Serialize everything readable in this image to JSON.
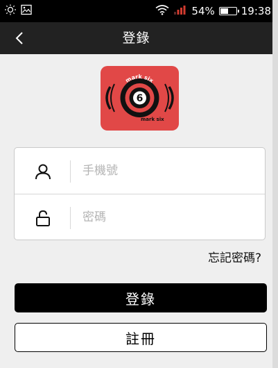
{
  "status_bar": {
    "battery_percent_text": "54%",
    "battery_level": 0.54,
    "time": "19:38",
    "icons": [
      "brightness-icon",
      "image-notification-icon",
      "wifi-icon",
      "cellular-signal-icon",
      "battery-icon"
    ]
  },
  "nav": {
    "title": "登錄",
    "back_icon": "chevron-left-icon"
  },
  "logo": {
    "icon": "mark-six-ball-logo",
    "text_top": "mark six",
    "text_bottom": "mark six",
    "ball_number": "6",
    "colors": {
      "background": "#e14847"
    }
  },
  "form": {
    "phone": {
      "icon": "user-icon",
      "placeholder": "手機號",
      "value": ""
    },
    "password": {
      "icon": "unlock-icon",
      "placeholder": "密碼",
      "value": ""
    }
  },
  "forgot_password_label": "忘記密碼?",
  "buttons": {
    "login_label": "登錄",
    "register_label": "註冊"
  },
  "colors": {
    "nav_background": "#222222",
    "page_background": "#efefef",
    "primary_button": "#000000"
  }
}
